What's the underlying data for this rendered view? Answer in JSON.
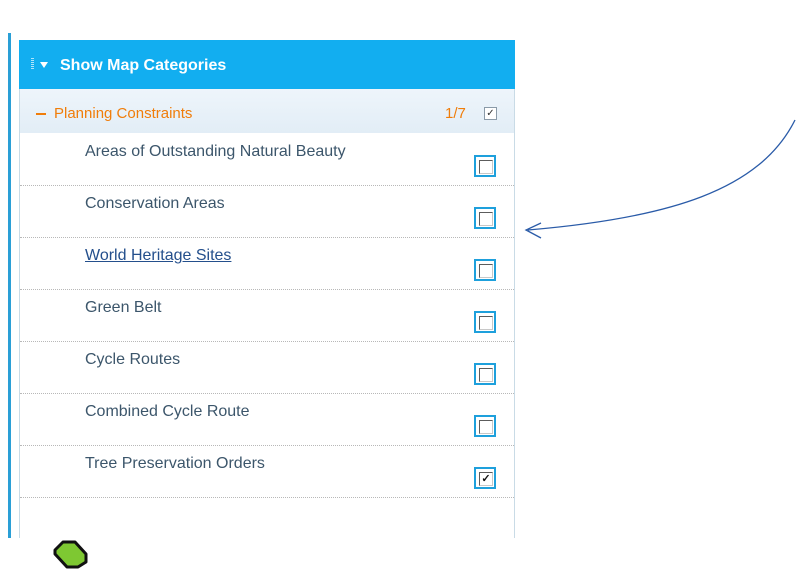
{
  "panel": {
    "header_title": "Show Map Categories"
  },
  "category": {
    "title": "Planning Constraints",
    "count": "1/7",
    "checked": true
  },
  "layers": [
    {
      "label": "Areas of Outstanding Natural Beauty",
      "checked": false,
      "link": false
    },
    {
      "label": "Conservation Areas",
      "checked": false,
      "link": false
    },
    {
      "label": "World Heritage Sites",
      "checked": false,
      "link": true
    },
    {
      "label": "Green Belt",
      "checked": false,
      "link": false
    },
    {
      "label": "Cycle Routes",
      "checked": false,
      "link": false
    },
    {
      "label": "Combined Cycle Route",
      "checked": false,
      "link": false
    },
    {
      "label": "Tree Preservation Orders",
      "checked": true,
      "link": false
    }
  ],
  "colors": {
    "header_bg": "#12aef0",
    "category_text": "#f07d0a",
    "checkbox_border": "#1ea0dc",
    "annotation_arrow": "#2a5ba8",
    "legend_icon_fill": "#7ec832"
  },
  "icons": {
    "grip": "grip-handle-icon",
    "collapse": "triangle-down-icon",
    "category_toggle": "minus-icon",
    "checkmark": "✓",
    "legend": "hexagon-icon",
    "annotation": "curved-arrow-icon"
  }
}
